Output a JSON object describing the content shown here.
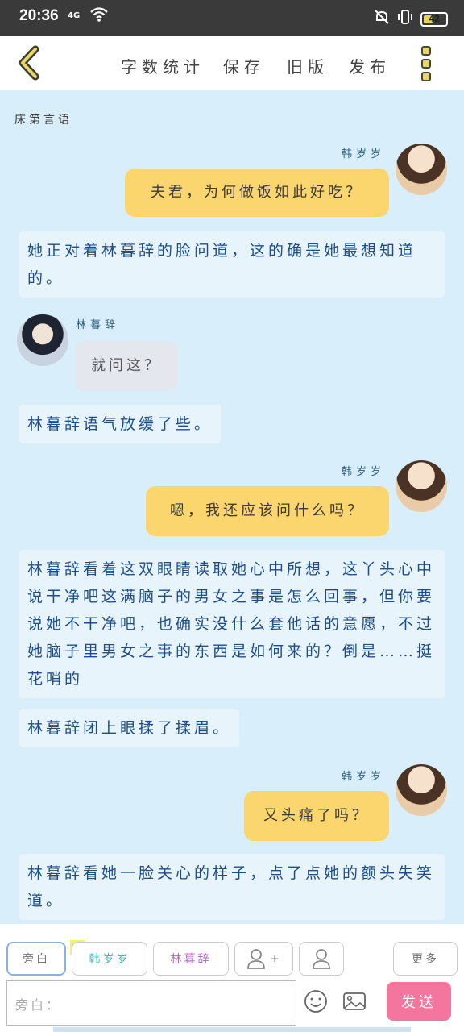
{
  "status_bar": {
    "time": "20:36",
    "signal_label": "4G",
    "battery": "42"
  },
  "toolbar": {
    "items": [
      "字数统计",
      "保存",
      "旧版",
      "发布"
    ]
  },
  "chat": {
    "heading": "床第言语",
    "messages": [
      {
        "type": "right",
        "name": "韩岁岁",
        "text": "夫君，为何做饭如此好吃？"
      },
      {
        "type": "narration",
        "text": "她正对着林暮辞的脸问道，这的确是她最想知道的。"
      },
      {
        "type": "left",
        "name": "林暮辞",
        "text": "就问这？"
      },
      {
        "type": "narration",
        "text": "林暮辞语气放缓了些。"
      },
      {
        "type": "right",
        "name": "韩岁岁",
        "text": "嗯，我还应该问什么吗？"
      },
      {
        "type": "narration",
        "text": "林暮辞看着这双眼睛读取她心中所想，这丫头心中说干净吧这满脑子的男女之事是怎么回事，但你要说她不干净吧，也确实没什么套他话的意愿，不过她脑子里男女之事的东西是如何来的？倒是……挺花哨的"
      },
      {
        "type": "narration",
        "text": "林暮辞闭上眼揉了揉眉。"
      },
      {
        "type": "right",
        "name": "韩岁岁",
        "text": "又头痛了吗？"
      },
      {
        "type": "narration",
        "text": "林暮辞看她一脸关心的样子，点了点她的额头失笑道。"
      }
    ]
  },
  "bottom": {
    "roles": [
      "旁白",
      "韩岁岁",
      "林暮辞"
    ],
    "main_badge": "主",
    "add_role_symbol": "+",
    "more_label": "更多",
    "input_placeholder": "旁白：",
    "send_label": "发送"
  },
  "colors": {
    "accent_yellow": "#fbd66e",
    "send_pink": "#f4769f",
    "chat_bg": "#d8eefa",
    "narration_text": "#1d4d86"
  }
}
